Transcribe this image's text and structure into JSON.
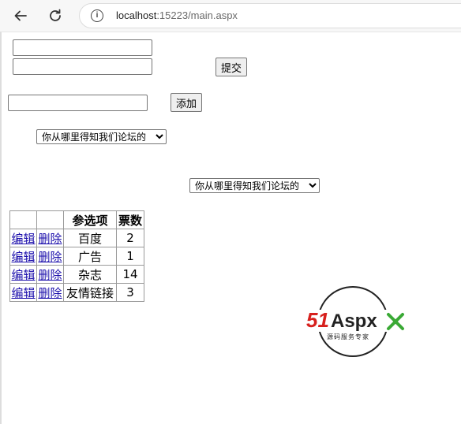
{
  "browser": {
    "url_host": "localhost",
    "url_rest": ":15223/main.aspx",
    "back_icon": "arrow-left-icon",
    "reload_icon": "reload-icon",
    "info_icon": "info-icon"
  },
  "form": {
    "input1_value": "",
    "input2_value": "",
    "submit_label": "提交",
    "add_input_value": "",
    "add_label": "添加",
    "select1_selected": "你从哪里得知我们论坛的",
    "select2_selected": "你从哪里得知我们论坛的"
  },
  "table": {
    "headers": [
      "",
      "",
      "参选项",
      "票数"
    ],
    "rows": [
      {
        "edit": "编辑",
        "delete": "删除",
        "option": "百度",
        "votes": "2"
      },
      {
        "edit": "编辑",
        "delete": "删除",
        "option": "广告",
        "votes": "1"
      },
      {
        "edit": "编辑",
        "delete": "删除",
        "option": "杂志",
        "votes": "14"
      },
      {
        "edit": "编辑",
        "delete": "删除",
        "option": "友情链接",
        "votes": "3"
      }
    ]
  },
  "logo": {
    "text_51": "51",
    "text_aspx": "Aspx",
    "tagline": "源码服务专家",
    "colors": {
      "red": "#d7201d",
      "dark": "#222222",
      "green": "#3aa935"
    }
  }
}
